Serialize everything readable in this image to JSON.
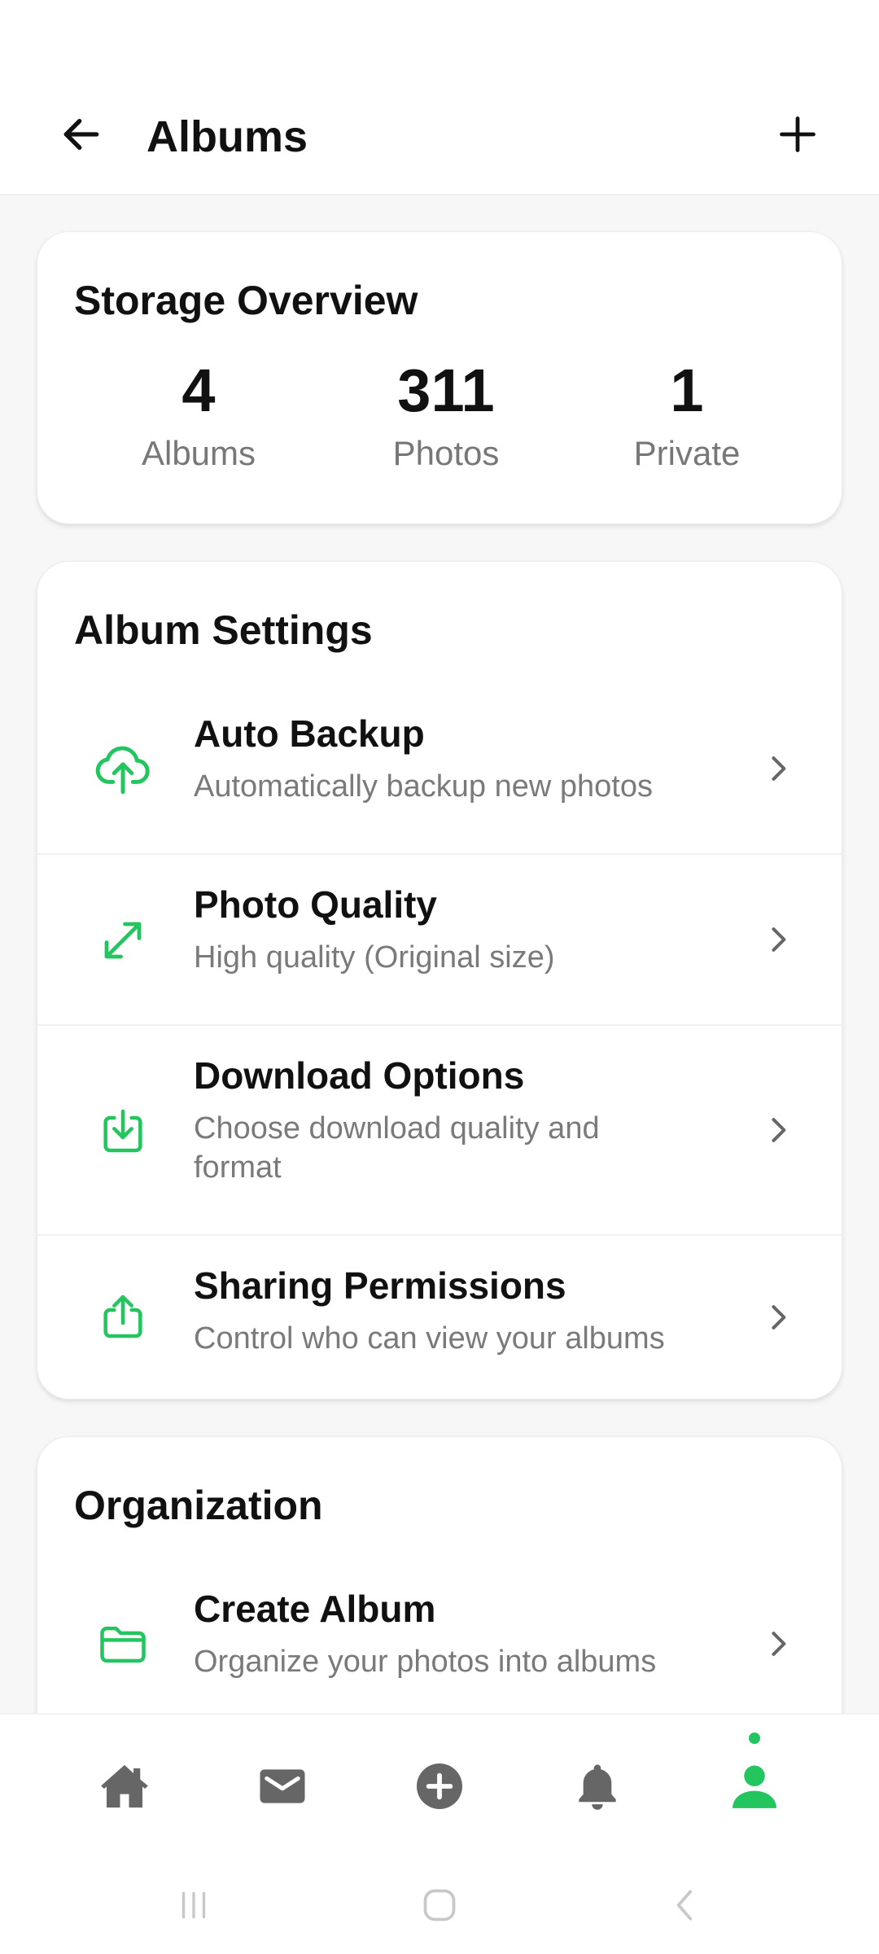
{
  "header": {
    "title": "Albums"
  },
  "storage": {
    "title": "Storage Overview",
    "stats": [
      {
        "value": "4",
        "label": "Albums"
      },
      {
        "value": "311",
        "label": "Photos"
      },
      {
        "value": "1",
        "label": "Private"
      }
    ]
  },
  "album_settings": {
    "title": "Album Settings",
    "items": [
      {
        "title": "Auto Backup",
        "subtitle": "Automatically backup new photos",
        "icon": "cloud-upload-icon"
      },
      {
        "title": "Photo Quality",
        "subtitle": "High quality (Original size)",
        "icon": "expand-arrows-icon"
      },
      {
        "title": "Download Options",
        "subtitle": "Choose download quality and format",
        "icon": "download-icon"
      },
      {
        "title": "Sharing Permissions",
        "subtitle": "Control who can view your albums",
        "icon": "share-icon"
      }
    ]
  },
  "organization": {
    "title": "Organization",
    "items": [
      {
        "title": "Create Album",
        "subtitle": "Organize your photos into albums",
        "icon": "folder-icon"
      }
    ]
  },
  "nav": {
    "items": [
      "home-icon",
      "mail-icon",
      "add-circle-icon",
      "bell-icon",
      "profile-icon"
    ],
    "active_index": 4
  },
  "colors": {
    "accent": "#22c55e",
    "text": "#111111",
    "muted": "#7a7a7a",
    "nav_inactive": "#666666"
  }
}
